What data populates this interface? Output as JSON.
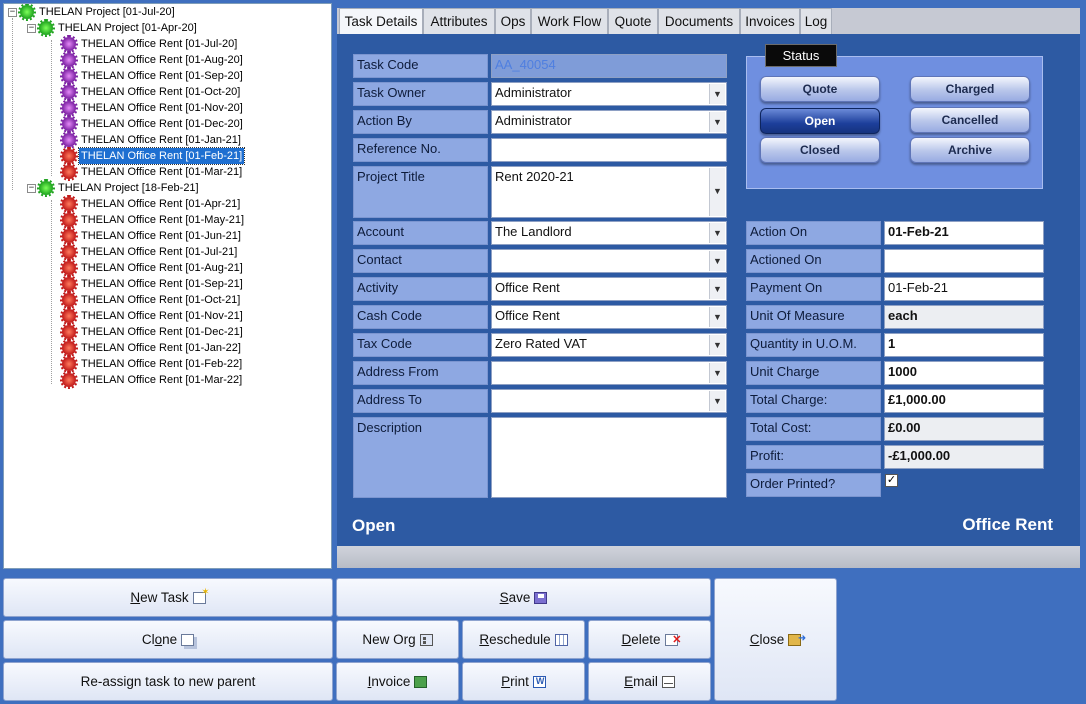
{
  "tree": {
    "root": "THELAN Project [01-Jul-20]",
    "projects": [
      {
        "label": "THELAN Project [01-Apr-20]",
        "items": [
          {
            "label": "THELAN Office Rent [01-Jul-20]",
            "color": "purple"
          },
          {
            "label": "THELAN Office Rent [01-Aug-20]",
            "color": "purple"
          },
          {
            "label": "THELAN Office Rent [01-Sep-20]",
            "color": "purple"
          },
          {
            "label": "THELAN Office Rent [01-Oct-20]",
            "color": "purple"
          },
          {
            "label": "THELAN Office Rent [01-Nov-20]",
            "color": "purple"
          },
          {
            "label": "THELAN Office Rent [01-Dec-20]",
            "color": "purple"
          },
          {
            "label": "THELAN Office Rent [01-Jan-21]",
            "color": "purple"
          },
          {
            "label": "THELAN Office Rent [01-Feb-21]",
            "color": "red",
            "selected": true
          },
          {
            "label": "THELAN Office Rent [01-Mar-21]",
            "color": "red"
          }
        ]
      },
      {
        "label": "THELAN Project [18-Feb-21]",
        "items": [
          {
            "label": "THELAN Office Rent [01-Apr-21]",
            "color": "red"
          },
          {
            "label": "THELAN Office Rent [01-May-21]",
            "color": "red"
          },
          {
            "label": "THELAN Office Rent [01-Jun-21]",
            "color": "red"
          },
          {
            "label": "THELAN Office Rent [01-Jul-21]",
            "color": "red"
          },
          {
            "label": "THELAN Office Rent [01-Aug-21]",
            "color": "red"
          },
          {
            "label": "THELAN Office Rent [01-Sep-21]",
            "color": "red"
          },
          {
            "label": "THELAN Office Rent [01-Oct-21]",
            "color": "red"
          },
          {
            "label": "THELAN Office Rent [01-Nov-21]",
            "color": "red"
          },
          {
            "label": "THELAN Office Rent [01-Dec-21]",
            "color": "red"
          },
          {
            "label": "THELAN Office Rent [01-Jan-22]",
            "color": "red"
          },
          {
            "label": "THELAN Office Rent [01-Feb-22]",
            "color": "red"
          },
          {
            "label": "THELAN Office Rent [01-Mar-22]",
            "color": "red"
          }
        ]
      }
    ]
  },
  "tabs": [
    "Task Details",
    "Attributes",
    "Ops",
    "Work Flow",
    "Quote",
    "Documents",
    "Invoices",
    "Log"
  ],
  "active_tab": "Task Details",
  "form": {
    "task_code": {
      "label": "Task Code",
      "value": "AA_40054"
    },
    "task_owner": {
      "label": "Task Owner",
      "value": "Administrator"
    },
    "action_by": {
      "label": "Action By",
      "value": "Administrator"
    },
    "reference_no": {
      "label": "Reference No.",
      "value": ""
    },
    "project_title": {
      "label": "Project Title",
      "value": "Rent 2020-21"
    },
    "account": {
      "label": "Account",
      "value": "The Landlord"
    },
    "contact": {
      "label": "Contact",
      "value": ""
    },
    "activity": {
      "label": "Activity",
      "value": "Office Rent"
    },
    "cash_code": {
      "label": "Cash Code",
      "value": "Office Rent"
    },
    "tax_code": {
      "label": "Tax Code",
      "value": "Zero Rated VAT"
    },
    "address_from": {
      "label": "Address From",
      "value": ""
    },
    "address_to": {
      "label": "Address To",
      "value": ""
    },
    "description": {
      "label": "Description",
      "value": ""
    }
  },
  "status": {
    "title": "Status",
    "buttons": {
      "quote": "Quote",
      "open": "Open",
      "closed": "Closed",
      "charged": "Charged",
      "cancelled": "Cancelled",
      "archive": "Archive"
    },
    "active": "Open"
  },
  "details": {
    "action_on": {
      "label": "Action On",
      "value": "01-Feb-21"
    },
    "actioned_on": {
      "label": "Actioned On",
      "value": ""
    },
    "payment_on": {
      "label": "Payment On",
      "value": "01-Feb-21"
    },
    "unit_of_measure": {
      "label": "Unit Of Measure",
      "value": "each"
    },
    "quantity": {
      "label": "Quantity in U.O.M.",
      "value": "1"
    },
    "unit_charge": {
      "label": "Unit Charge",
      "value": "1000"
    },
    "total_charge": {
      "label": "Total Charge:",
      "value": "£1,000.00"
    },
    "total_cost": {
      "label": "Total Cost:",
      "value": "£0.00"
    },
    "profit": {
      "label": "Profit:",
      "value": "-£1,000.00"
    },
    "order_printed": {
      "label": "Order Printed?",
      "checked": true,
      "mark": "✓"
    }
  },
  "footer": {
    "status_text": "Open",
    "activity_text": "Office Rent"
  },
  "buttons": {
    "new_task_pre": "N",
    "new_task_rest": "ew Task",
    "save_pre": "S",
    "save_rest": "ave",
    "clone_pre": "Cl",
    "clone_u": "o",
    "clone_rest": "ne",
    "new_org": "New Org",
    "reschedule_pre": "",
    "reschedule_u": "R",
    "reschedule_rest": "eschedule",
    "delete_u": "D",
    "delete_rest": "elete",
    "close_u": "C",
    "close_rest": "lose",
    "reassign": "Re-assign task to new parent",
    "invoice_u": "I",
    "invoice_rest": "nvoice",
    "print_u": "P",
    "print_rest": "rint",
    "email_u": "E",
    "email_rest": "mail"
  }
}
